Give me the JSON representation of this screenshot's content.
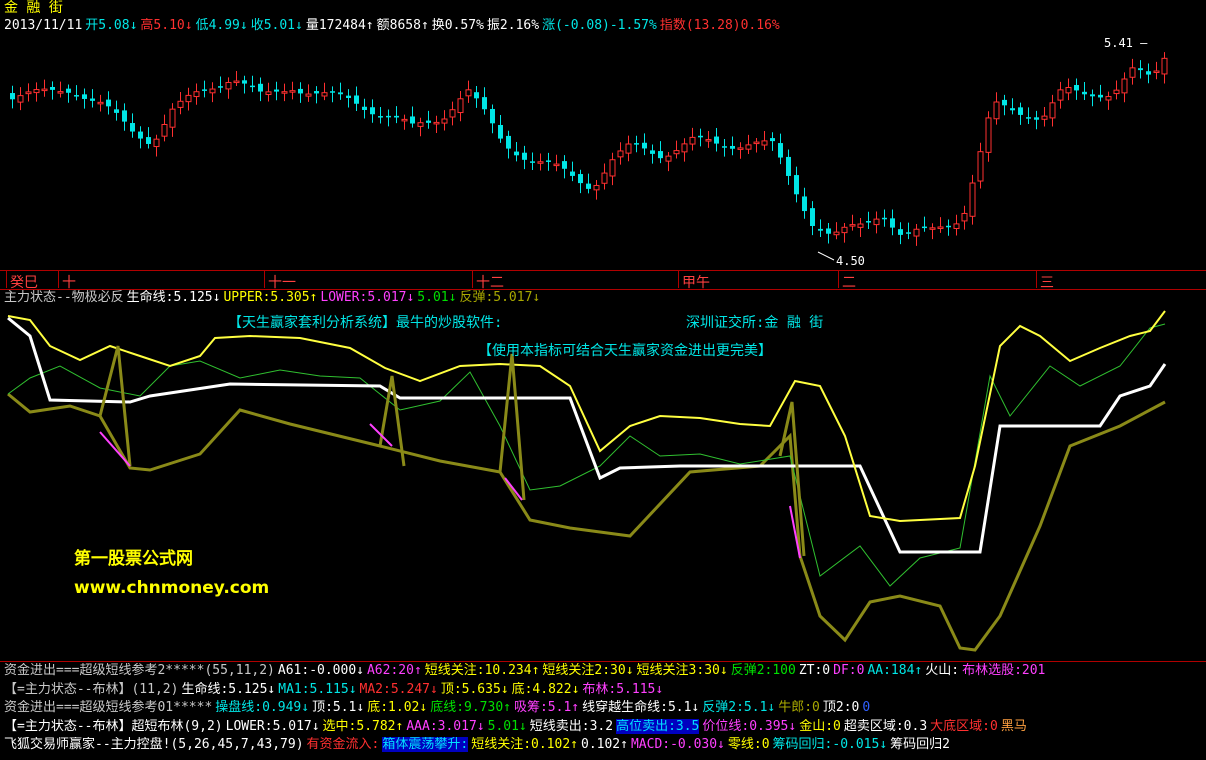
{
  "header": {
    "title": "金 融 街",
    "date": "2013/11/11",
    "items": [
      {
        "text": "开5.08",
        "arrow": "↓",
        "cls": "cyan"
      },
      {
        "text": "高5.10",
        "arrow": "↓",
        "cls": "red"
      },
      {
        "text": "低4.99",
        "arrow": "↓",
        "cls": "cyan"
      },
      {
        "text": "收5.01",
        "arrow": "↓",
        "cls": "cyan"
      },
      {
        "text": "量172484",
        "arrow": "↑",
        "cls": "wht"
      },
      {
        "text": "额8658",
        "arrow": "↑",
        "cls": "wht"
      },
      {
        "text": "换0.57%",
        "arrow": "",
        "cls": "wht"
      },
      {
        "text": "振2.16%",
        "arrow": "",
        "cls": "wht"
      },
      {
        "text": "涨(-0.08)-1.57%",
        "arrow": "",
        "cls": "cyan"
      },
      {
        "text": "指数(13.28)0.16%",
        "arrow": "",
        "cls": "red"
      }
    ]
  },
  "main_chart": {
    "high_label": "5.41",
    "low_label": "4.50",
    "colors": {
      "up": "#ff3030",
      "down": "#00e6e6"
    }
  },
  "date_axis": [
    "癸巳",
    "十",
    "十一",
    "十二",
    "甲午",
    "二",
    "三"
  ],
  "indicator": {
    "name": "主力状态--物极必反",
    "values": [
      {
        "text": "生命线:5.125",
        "arrow": "↓",
        "cls": "wht"
      },
      {
        "text": "UPPER:5.305",
        "arrow": "↑",
        "cls": "yel"
      },
      {
        "text": "LOWER:5.017",
        "arrow": "↓",
        "cls": "mag"
      },
      {
        "text": "5.01",
        "arrow": "↓",
        "cls": "grn"
      },
      {
        "text": "反弹:5.017",
        "arrow": "↓",
        "cls": "olv"
      }
    ],
    "note1": "【天生赢家套利分析系统】最牛的炒股软件:",
    "note2": "深圳证交所:金 融 街",
    "note3": "【使用本指标可结合天生赢家资金进出更完美】",
    "watermark1": "第一股票公式网",
    "watermark2": "www.chnmoney.com"
  },
  "legend_rows": [
    [
      {
        "text": "资金进出===超级短线参考2*****(55,11,2)",
        "cls": "gry"
      },
      {
        "text": "A61:-0.000↓",
        "cls": "wht"
      },
      {
        "text": "A62:20↑",
        "cls": "mag"
      },
      {
        "text": "短线关注:10.234↑",
        "cls": "yel"
      },
      {
        "text": "短线关注2:30↓",
        "cls": "yel"
      },
      {
        "text": "短线关注3:30↓",
        "cls": "yel"
      },
      {
        "text": "反弹2:100",
        "cls": "grn"
      },
      {
        "text": "ZT:0",
        "cls": "wht"
      },
      {
        "text": "DF:0",
        "cls": "mag"
      },
      {
        "text": "AA:184↑",
        "cls": "cyan"
      },
      {
        "text": "火山:",
        "cls": "wht"
      },
      {
        "text": "布林选股:201",
        "cls": "mag"
      }
    ],
    [
      {
        "text": "【=主力状态--布林】(11,2)",
        "cls": "gry"
      },
      {
        "text": "生命线:5.125↓",
        "cls": "wht"
      },
      {
        "text": "MA1:5.115↓",
        "cls": "cyan"
      },
      {
        "text": "MA2:5.247↓",
        "cls": "red"
      },
      {
        "text": "顶:5.635↓",
        "cls": "yel"
      },
      {
        "text": "底:4.822↓",
        "cls": "yel"
      },
      {
        "text": "布林:5.115↓",
        "cls": "mag"
      }
    ],
    [
      {
        "text": "资金进出===超级短线参考01*****",
        "cls": "gry"
      },
      {
        "text": "操盘线:0.949↓",
        "cls": "cyan"
      },
      {
        "text": "顶:5.1↓",
        "cls": "wht"
      },
      {
        "text": "底:1.02↓",
        "cls": "yel"
      },
      {
        "text": "底线:9.730↑",
        "cls": "grn"
      },
      {
        "text": "吸筹:5.1↑",
        "cls": "mag"
      },
      {
        "text": "线穿越生命线:5.1↓",
        "cls": "wht"
      },
      {
        "text": "反弹2:5.1↓",
        "cls": "cyan"
      },
      {
        "text": "牛郎:0",
        "cls": "olv"
      },
      {
        "text": "顶2:0",
        "cls": "wht"
      },
      {
        "text": "0",
        "cls": "blu"
      }
    ],
    [
      {
        "text": "【=主力状态--布林】超短布林(9,2)",
        "cls": "wht"
      },
      {
        "text": "LOWER:5.017↓",
        "cls": "wht"
      },
      {
        "text": "选中:5.782↑",
        "cls": "yel"
      },
      {
        "text": "AAA:3.017↓",
        "cls": "mag"
      },
      {
        "text": "5.01↓",
        "cls": "grn"
      },
      {
        "text": "短线卖出:3.2",
        "cls": "wht"
      },
      {
        "text": "高位卖出:3.5",
        "cls": "hl-blu"
      },
      {
        "text": "价位线:0.395↓",
        "cls": "mag"
      },
      {
        "text": "金山:0",
        "cls": "yel"
      },
      {
        "text": "超卖区域:0.3",
        "cls": "wht"
      },
      {
        "text": "大底区域:0",
        "cls": "red"
      },
      {
        "text": "黑马",
        "cls": "org"
      }
    ],
    [
      {
        "text": "飞狐交易师赢家--主力控盘!(5,26,45,7,43,79)",
        "cls": "wht"
      },
      {
        "text": "有资金流入:",
        "cls": "red"
      },
      {
        "text": "箱体震荡攀升:",
        "cls": "hl-blu"
      },
      {
        "text": "短线关注:0.102↑",
        "cls": "yel"
      },
      {
        "text": "0.102↑",
        "cls": "wht"
      },
      {
        "text": "MACD:-0.030↓",
        "cls": "mag"
      },
      {
        "text": "零线:0",
        "cls": "yel"
      },
      {
        "text": "筹码回归:-0.015↓",
        "cls": "cyan"
      },
      {
        "text": "筹码回归2",
        "cls": "wht"
      }
    ]
  ]
}
